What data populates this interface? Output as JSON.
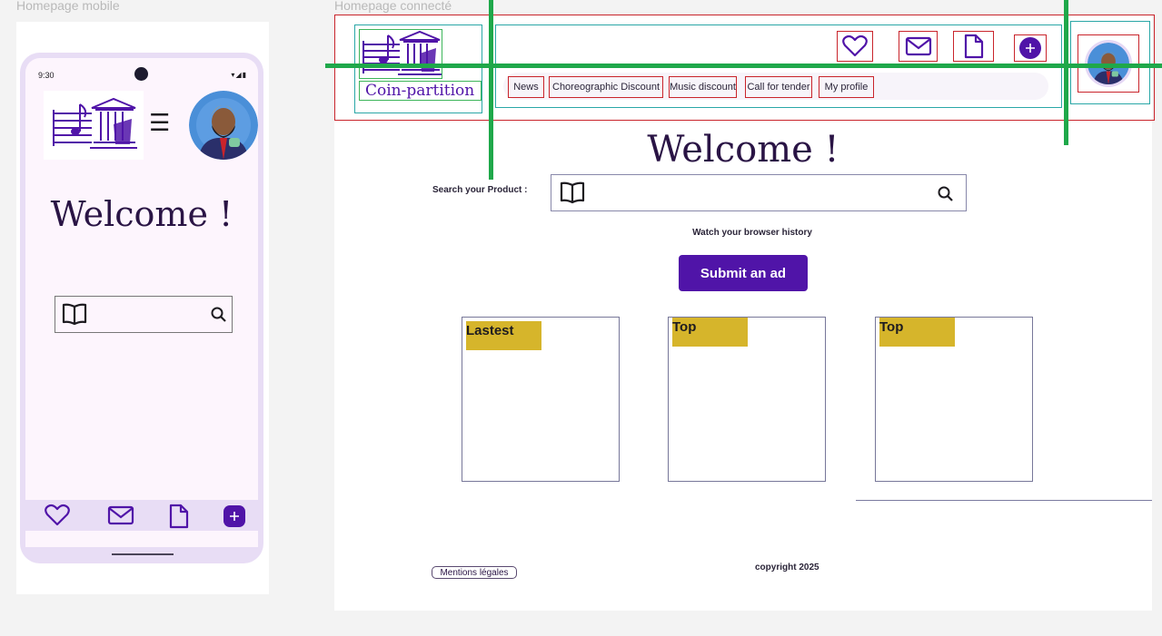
{
  "frames": {
    "mobile_label": "Homepage mobile",
    "desktop_label": "Homepage connecté"
  },
  "mobile": {
    "status_time": "9:30",
    "status_icons": "▾◢▮",
    "menu_glyph": "☰",
    "welcome": "Welcome !",
    "bottom_nav": [
      "heart-icon",
      "mail-icon",
      "document-icon",
      "add-icon"
    ]
  },
  "desktop": {
    "logo_text": "Coin-partition",
    "header_icons": [
      "heart-icon",
      "mail-icon",
      "document-icon",
      "add-icon"
    ],
    "nav_links": [
      "News",
      "Choreographic Discount",
      "Music discount",
      "Call for tender",
      "My profile"
    ],
    "welcome": "Welcome !",
    "search_label": "Search your Product :",
    "history_link": "Watch your browser history",
    "submit_label": "Submit an ad",
    "cards": [
      {
        "tag": "Lastest"
      },
      {
        "tag": "Top"
      },
      {
        "tag": "Top"
      }
    ],
    "legal_label": "Mentions légales",
    "copyright": "copyright 2025"
  },
  "colors": {
    "brand": "#5014a8",
    "text_dark": "#2a1445",
    "tag_yellow": "#d6b52b",
    "guide_green": "#1fa84a",
    "outline_red": "#c9242b",
    "outline_teal": "#2aa7a7"
  }
}
